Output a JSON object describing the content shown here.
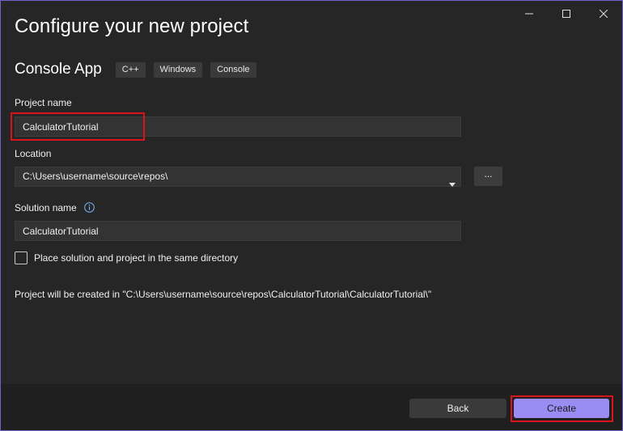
{
  "window": {
    "controls": [
      "minimize-icon",
      "maximize-icon",
      "close-icon"
    ]
  },
  "header": {
    "title": "Configure your new project"
  },
  "template": {
    "name": "Console App",
    "tags": [
      "C++",
      "Windows",
      "Console"
    ]
  },
  "form": {
    "project_name_label": "Project name",
    "project_name_value": "CalculatorTutorial",
    "location_label": "Location",
    "location_value": "C:\\Users\\username\\source\\repos\\",
    "browse_label": "...",
    "solution_name_label": "Solution name",
    "solution_name_value": "CalculatorTutorial",
    "same_directory_label": "Place solution and project in the same directory",
    "same_directory_checked": false,
    "path_note": "Project will be created in \"C:\\Users\\username\\source\\repos\\CalculatorTutorial\\CalculatorTutorial\\\""
  },
  "footer": {
    "back_label": "Back",
    "create_label": "Create"
  },
  "colors": {
    "accent": "#9a8cf2",
    "highlight": "#d9141b",
    "border": "#6e63c9"
  }
}
